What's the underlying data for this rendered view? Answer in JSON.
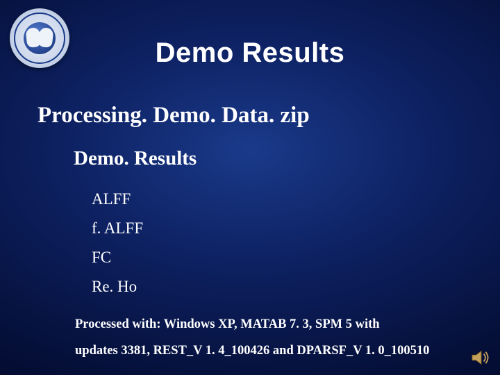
{
  "title": "Demo Results",
  "level1": "Processing. Demo. Data. zip",
  "level2": "Demo. Results",
  "items": [
    "ALFF",
    "f. ALFF",
    "FC",
    "Re. Ho"
  ],
  "footer_line1": "Processed with: Windows XP, MATAB 7. 3, SPM 5 with",
  "footer_line2": "updates 3381, REST_V 1. 4_100426 and DPARSF_V 1. 0_100510",
  "icons": {
    "logo": "brain-logo",
    "speaker": "speaker-icon"
  }
}
